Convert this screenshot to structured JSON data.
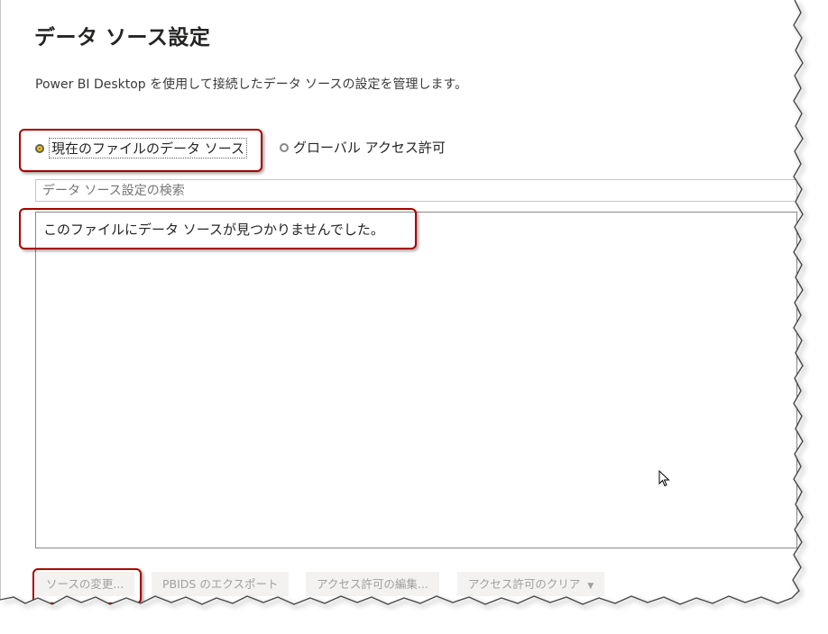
{
  "dialog": {
    "title": "データ ソース設定",
    "description": "Power BI Desktop を使用して接続したデータ ソースの設定を管理します。"
  },
  "scope": {
    "options": [
      {
        "label": "現在のファイルのデータ ソース",
        "selected": true
      },
      {
        "label": "グローバル アクセス許可",
        "selected": false
      }
    ]
  },
  "search": {
    "placeholder": "データ ソース設定の検索"
  },
  "list": {
    "empty_message": "このファイルにデータ ソースが見つかりませんでした。"
  },
  "buttons": {
    "change_source": "ソースの変更...",
    "export_pbids": "PBIDS のエクスポート",
    "edit_permissions": "アクセス許可の編集...",
    "clear_permissions": "アクセス許可のクリア"
  },
  "colors": {
    "accent": "#f2c811",
    "highlight": "#a80000",
    "disabled_text": "#a19f9d"
  },
  "icons": {
    "dropdown": "chevron-down-icon",
    "cursor": "mouse-pointer-icon"
  }
}
